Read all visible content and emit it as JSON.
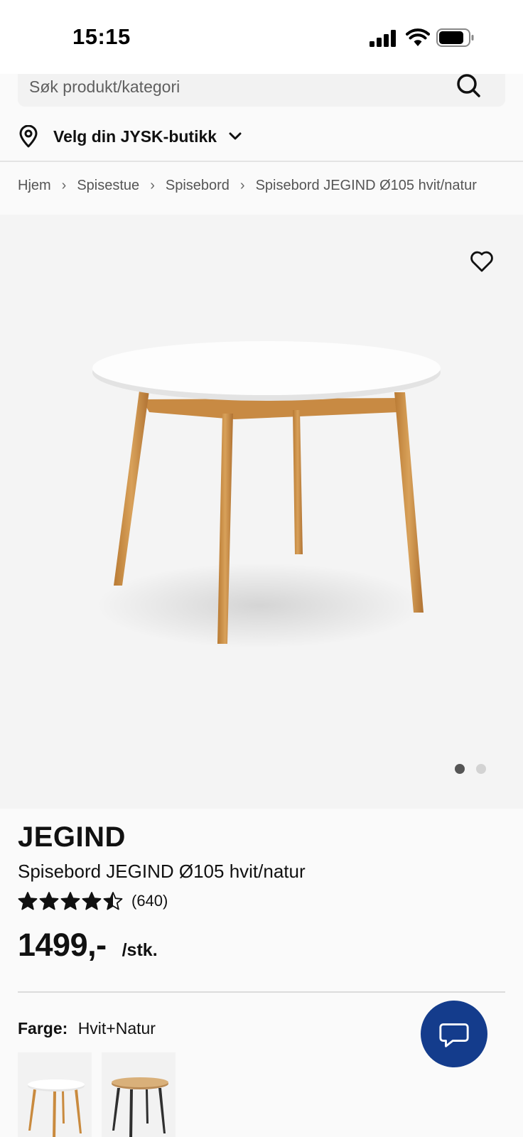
{
  "status_bar": {
    "time": "15:15"
  },
  "search": {
    "placeholder": "Søk produkt/kategori"
  },
  "store": {
    "label": "Velg din JYSK-butikk"
  },
  "breadcrumb": {
    "items": [
      "Hjem",
      "Spisestue",
      "Spisebord",
      "Spisebord JEGIND Ø105 hvit/natur"
    ],
    "separator": "›"
  },
  "gallery": {
    "image_count": 2,
    "active_index": 0
  },
  "product": {
    "brand": "JEGIND",
    "name": "Spisebord JEGIND Ø105 hvit/natur",
    "rating": 4.5,
    "rating_max": 5,
    "review_count": "(640)",
    "price": "1499,-",
    "price_unit": "/stk."
  },
  "color": {
    "label": "Farge:",
    "value": "Hvit+Natur",
    "swatches": [
      {
        "name": "Hvit+Natur",
        "selected": true
      },
      {
        "name": "Natur+Svart",
        "selected": false
      }
    ]
  },
  "colors": {
    "accent": "#143c8c",
    "wood": "#c98a3e",
    "tabletop": "#ffffff"
  },
  "icons": [
    "signal-icon",
    "wifi-icon",
    "battery-icon",
    "search-icon",
    "location-pin-icon",
    "chevron-down-icon",
    "heart-icon",
    "star-icon",
    "chat-icon"
  ]
}
